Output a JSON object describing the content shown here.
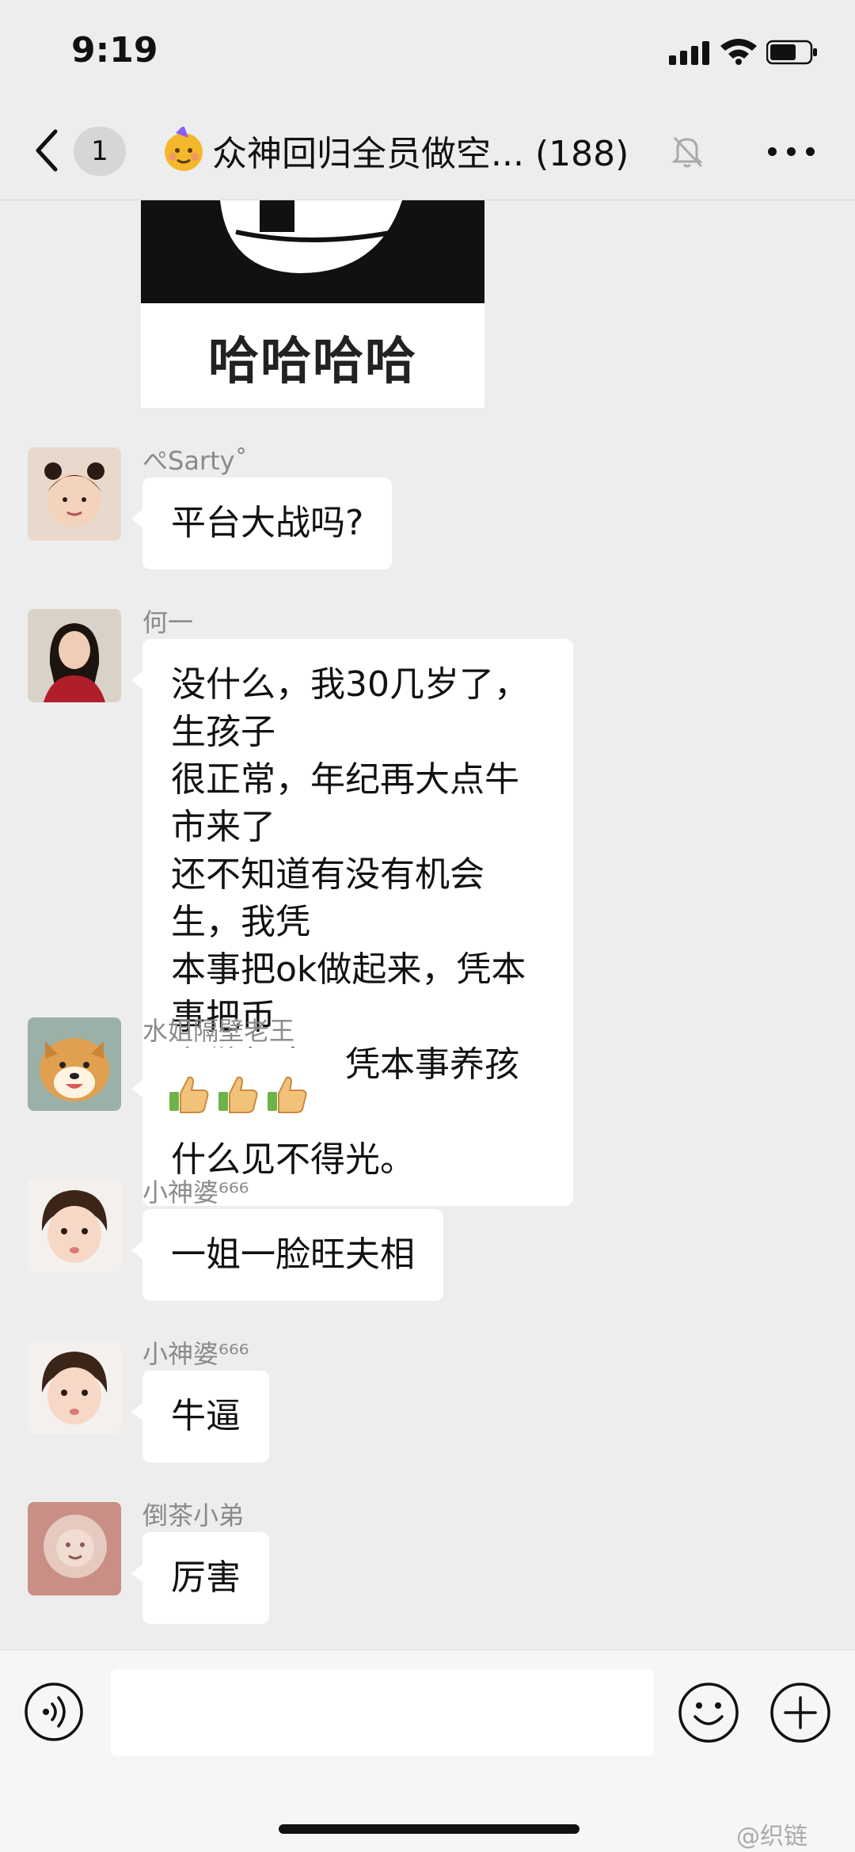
{
  "status_bar": {
    "time": "9:19"
  },
  "header": {
    "unread_count": "1",
    "title": "众神回归全员做空... (188)"
  },
  "sticker": {
    "caption": "哈哈哈哈"
  },
  "messages": [
    {
      "sender": "ぺSarty˚",
      "text": "平台大战吗?"
    },
    {
      "sender": "何一",
      "text_lines": [
        "没什么，我30几岁了，生孩子",
        "很正常，年纪再大点牛市来了",
        "还不知道有没有机会生，我凭",
        "本事把ok做起来，凭本事把币",
        "安做起来，凭本事养孩子，没",
        "什么见不得光。"
      ]
    },
    {
      "sender": "水姐隔壁老王",
      "emoji": "thumbs-up x3"
    },
    {
      "sender": "小神婆⁶⁶⁶",
      "text": "一姐一脸旺夫相"
    },
    {
      "sender": "小神婆⁶⁶⁶",
      "text": "牛逼"
    },
    {
      "sender": "倒茶小弟",
      "text": "厉害"
    }
  ],
  "input": {
    "value": ""
  },
  "watermark": "@织链"
}
